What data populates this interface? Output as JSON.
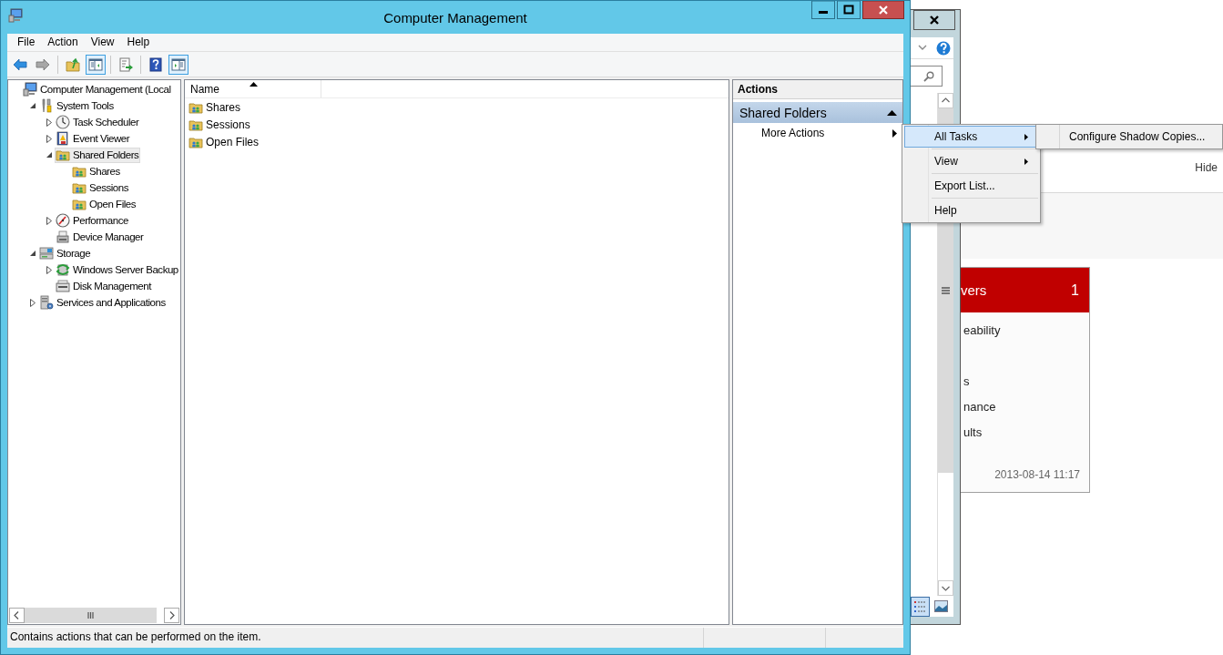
{
  "window": {
    "title": "Computer Management"
  },
  "menu": [
    {
      "label": "File"
    },
    {
      "label": "Action"
    },
    {
      "label": "View"
    },
    {
      "label": "Help"
    }
  ],
  "toolbar": [
    {
      "kind": "back",
      "pressed": false,
      "disabled": false
    },
    {
      "kind": "forward",
      "pressed": false,
      "disabled": true
    },
    {
      "kind": "separator"
    },
    {
      "kind": "up",
      "pressed": false,
      "disabled": false
    },
    {
      "kind": "tree-pane",
      "pressed": true,
      "disabled": false
    },
    {
      "kind": "separator"
    },
    {
      "kind": "export",
      "pressed": false,
      "disabled": false
    },
    {
      "kind": "separator"
    },
    {
      "kind": "help",
      "pressed": false,
      "disabled": false
    },
    {
      "kind": "action-pane",
      "pressed": true,
      "disabled": false
    }
  ],
  "tree": [
    {
      "label": "Computer Management (Local",
      "kind": "computer",
      "selected": false,
      "children": [
        {
          "label": "System Tools",
          "kind": "tools",
          "expanded": true,
          "selected": false,
          "children": [
            {
              "label": "Task Scheduler",
              "kind": "clock",
              "expanded": false,
              "selected": false
            },
            {
              "label": "Event Viewer",
              "kind": "log",
              "expanded": false,
              "selected": false
            },
            {
              "label": "Shared Folders",
              "kind": "share",
              "expanded": true,
              "selected": true,
              "children": [
                {
                  "label": "Shares",
                  "kind": "share",
                  "selected": false
                },
                {
                  "label": "Sessions",
                  "kind": "share",
                  "selected": false
                },
                {
                  "label": "Open Files",
                  "kind": "share",
                  "selected": false
                }
              ]
            },
            {
              "label": "Performance",
              "kind": "gauge",
              "expanded": false,
              "selected": false
            },
            {
              "label": "Device Manager",
              "kind": "device",
              "selected": false
            }
          ]
        },
        {
          "label": "Storage",
          "kind": "storage",
          "expanded": true,
          "selected": false,
          "children": [
            {
              "label": "Windows Server Backup",
              "kind": "backup",
              "expanded": false,
              "selected": false
            },
            {
              "label": "Disk Management",
              "kind": "disk",
              "selected": false
            }
          ]
        },
        {
          "label": "Services and Applications",
          "kind": "services",
          "expanded": false,
          "selected": false
        }
      ]
    }
  ],
  "list": {
    "columns": [
      {
        "label": "Name",
        "sorted": true
      }
    ],
    "rows": [
      {
        "name": "Shares",
        "selected": false
      },
      {
        "name": "Sessions",
        "selected": false
      },
      {
        "name": "Open Files",
        "selected": false
      }
    ]
  },
  "actions": {
    "title": "Actions",
    "section": {
      "label": "Shared Folders",
      "expanded": true
    },
    "items": [
      {
        "label": "More Actions",
        "submenu": true
      }
    ]
  },
  "context_menu": {
    "items": [
      {
        "label": "All Tasks",
        "submenu": true,
        "selected": true
      },
      {
        "label": "View",
        "submenu": true,
        "selected": false
      },
      {
        "label": "Export List...",
        "submenu": false,
        "selected": false
      },
      {
        "label": "Help",
        "submenu": false,
        "selected": false
      }
    ],
    "submenu": {
      "items": [
        {
          "label": "Configure Shadow Copies...",
          "selected": false
        }
      ]
    }
  },
  "status_bar": {
    "text": "Contains actions that can be performed on the item."
  },
  "background_window": {
    "hide_label": "Hide",
    "tile": {
      "title": "vers",
      "count": "1",
      "lines": [
        "eability",
        "s",
        "nance",
        "ults"
      ],
      "timestamp": "2013-08-14 11:17"
    }
  }
}
